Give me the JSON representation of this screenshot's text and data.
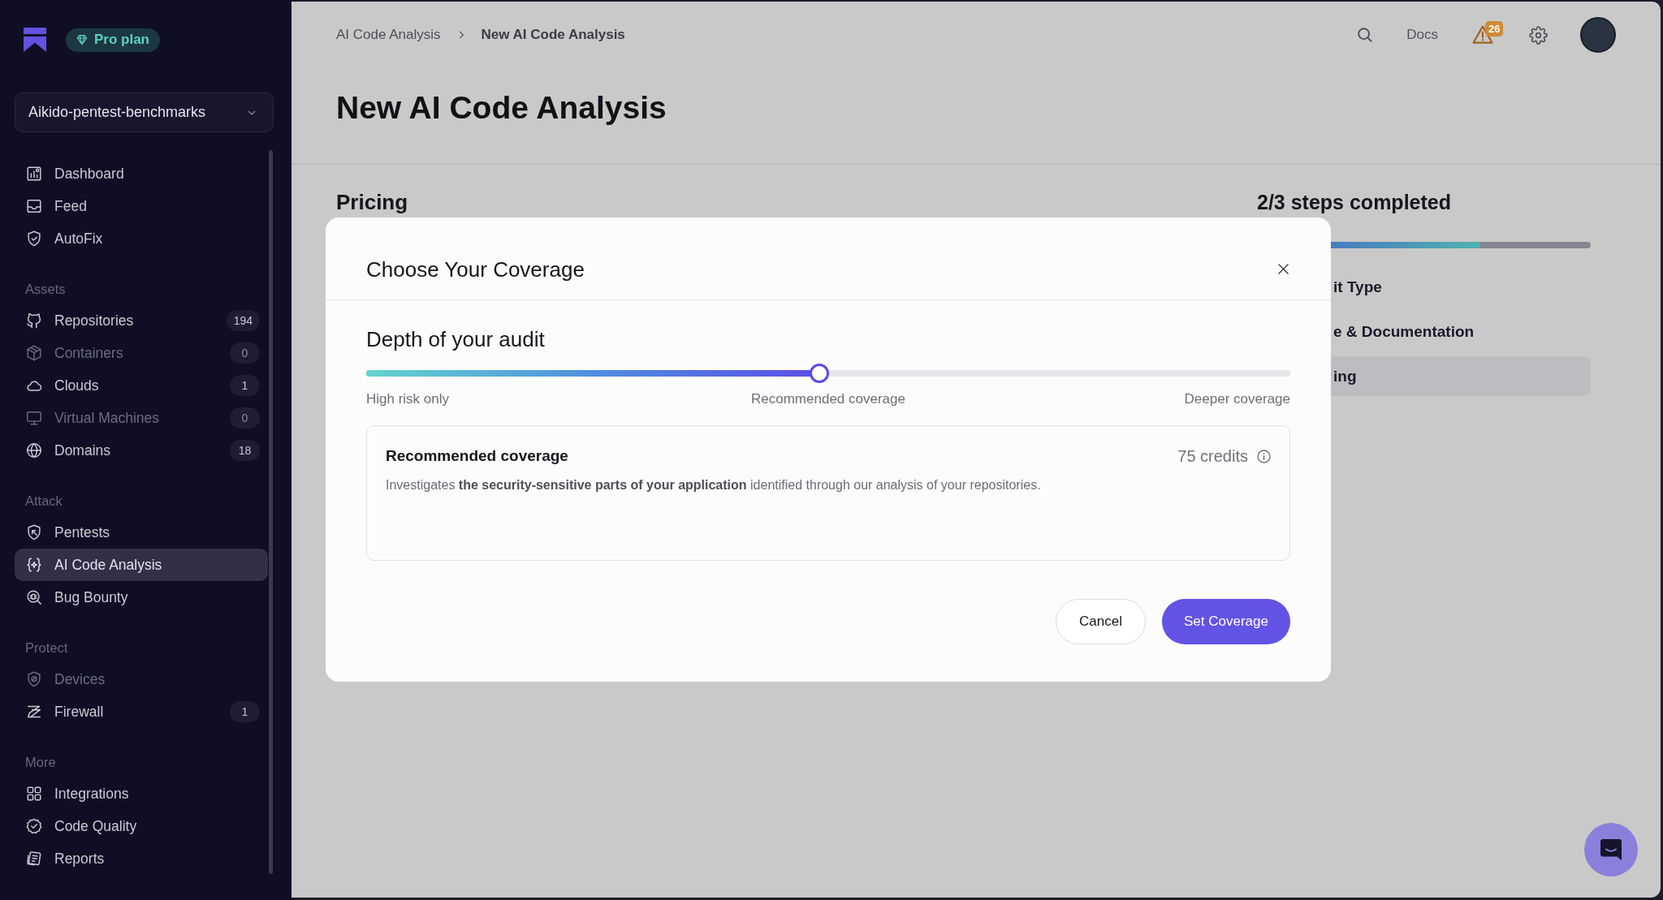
{
  "sidebar": {
    "plan": "Pro plan",
    "workspace": "Aikido-pentest-benchmarks",
    "sections": [
      {
        "items": [
          {
            "label": "Dashboard",
            "selected": false,
            "disabled": false
          },
          {
            "label": "Feed",
            "selected": false,
            "disabled": false
          },
          {
            "label": "AutoFix",
            "selected": false,
            "disabled": false
          }
        ]
      },
      {
        "title": "Assets",
        "items": [
          {
            "label": "Repositories",
            "count": "194",
            "selected": false,
            "disabled": false
          },
          {
            "label": "Containers",
            "count": "0",
            "selected": false,
            "disabled": true
          },
          {
            "label": "Clouds",
            "count": "1",
            "selected": false,
            "disabled": false
          },
          {
            "label": "Virtual Machines",
            "count": "0",
            "selected": false,
            "disabled": true
          },
          {
            "label": "Domains",
            "count": "18",
            "selected": false,
            "disabled": false
          }
        ]
      },
      {
        "title": "Attack",
        "items": [
          {
            "label": "Pentests",
            "selected": false,
            "disabled": false
          },
          {
            "label": "AI Code Analysis",
            "selected": true,
            "disabled": false
          },
          {
            "label": "Bug Bounty",
            "selected": false,
            "disabled": false
          }
        ]
      },
      {
        "title": "Protect",
        "items": [
          {
            "label": "Devices",
            "selected": false,
            "disabled": true
          },
          {
            "label": "Firewall",
            "count": "1",
            "selected": false,
            "disabled": false
          }
        ]
      },
      {
        "title": "More",
        "items": [
          {
            "label": "Integrations",
            "selected": false,
            "disabled": false
          },
          {
            "label": "Code Quality",
            "selected": false,
            "disabled": false
          },
          {
            "label": "Reports",
            "selected": false,
            "disabled": false
          }
        ]
      }
    ]
  },
  "header": {
    "breadcrumbs": [
      {
        "label": "AI Code Analysis",
        "current": false
      },
      {
        "label": "New AI Code Analysis",
        "current": true
      }
    ],
    "docs": "Docs",
    "alert_count": "26"
  },
  "page": {
    "title": "New AI Code Analysis",
    "section_title": "Pricing",
    "progress": {
      "title": "2/3 steps completed",
      "level": 0.67,
      "steps": [
        {
          "label": "it Type",
          "selected": false
        },
        {
          "label": "e & Documentation",
          "selected": false
        },
        {
          "label": "ing",
          "selected": true
        }
      ]
    }
  },
  "modal": {
    "title": "Choose Your Coverage",
    "heading": "Depth of your audit",
    "slider": {
      "level": 0.49,
      "labels": [
        "High risk only",
        "Recommended coverage",
        "Deeper coverage"
      ]
    },
    "option": {
      "title": "Recommended coverage",
      "credits": "75 credits",
      "description": "Investigates **the security-sensitive parts of your application** identified through our analysis of your repositories."
    },
    "buttons": [
      {
        "label": "Cancel",
        "kind": "secondary"
      },
      {
        "label": "Set Coverage",
        "kind": "primary"
      }
    ]
  }
}
